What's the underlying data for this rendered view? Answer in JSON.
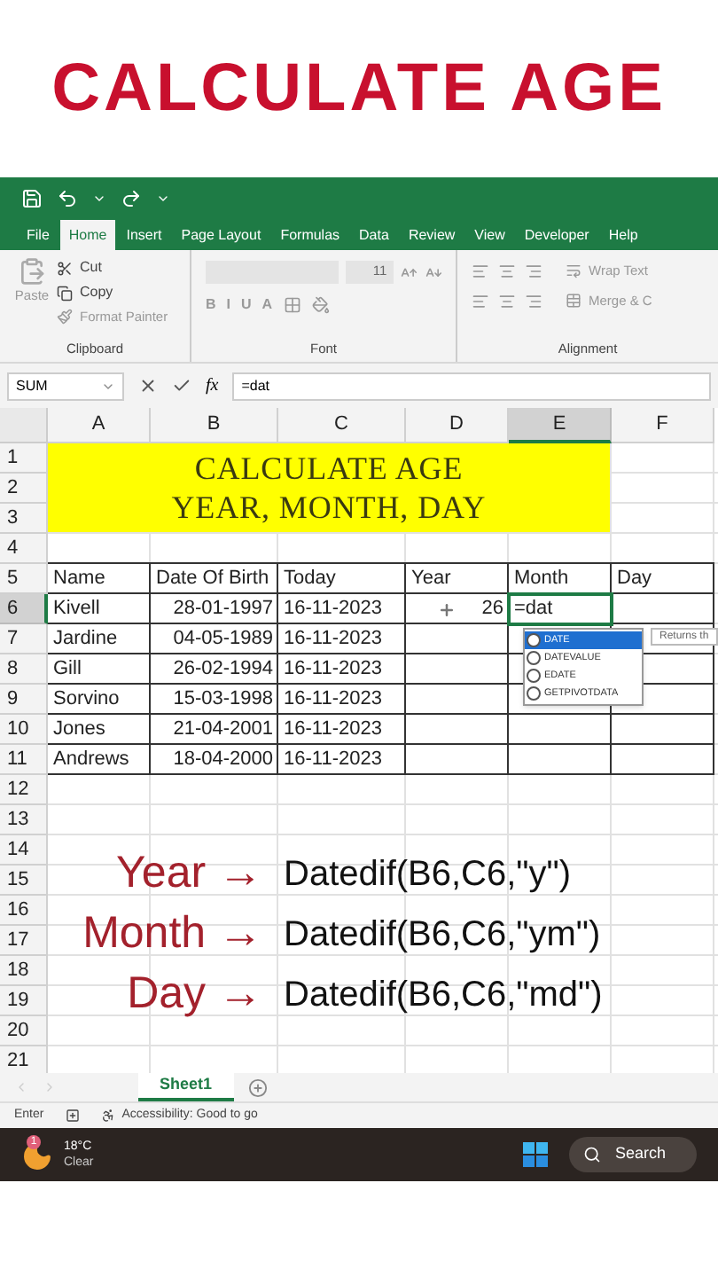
{
  "headline": "CALCULATE AGE",
  "ribbon_tabs": [
    {
      "label": "File",
      "selected": false
    },
    {
      "label": "Home",
      "selected": true
    },
    {
      "label": "Insert",
      "selected": false
    },
    {
      "label": "Page Layout",
      "selected": false
    },
    {
      "label": "Formulas",
      "selected": false
    },
    {
      "label": "Data",
      "selected": false
    },
    {
      "label": "Review",
      "selected": false
    },
    {
      "label": "View",
      "selected": false
    },
    {
      "label": "Developer",
      "selected": false
    },
    {
      "label": "Help",
      "selected": false
    }
  ],
  "clipboard": {
    "paste": "Paste",
    "cut": "Cut",
    "copy": "Copy",
    "format_painter": "Format Painter",
    "group": "Clipboard"
  },
  "font": {
    "size": "11",
    "buttons": [
      "B",
      "I",
      "U",
      "A"
    ],
    "group": "Font"
  },
  "alignment": {
    "wrap": "Wrap Text",
    "merge": "Merge & C",
    "group": "Alignment"
  },
  "formula_bar": {
    "name_box": "SUM",
    "fx": "fx",
    "formula": "=dat"
  },
  "columns": [
    {
      "label": "A",
      "selected": false
    },
    {
      "label": "B",
      "selected": false
    },
    {
      "label": "C",
      "selected": false
    },
    {
      "label": "D",
      "selected": false
    },
    {
      "label": "E",
      "selected": true
    },
    {
      "label": "F",
      "selected": false
    }
  ],
  "title_block": [
    "CALCULATE AGE",
    "YEAR, MONTH, DAY"
  ],
  "rows": [
    {
      "number": "1",
      "selected": false
    },
    {
      "number": "2",
      "selected": false
    },
    {
      "number": "3",
      "selected": false
    },
    {
      "number": "4",
      "selected": false
    },
    {
      "number": "5",
      "selected": false,
      "cells": [
        "Name",
        "Date Of Birth",
        "Today",
        "Year",
        "Month",
        "Day"
      ]
    },
    {
      "number": "6",
      "selected": true,
      "cells": [
        "Kivell",
        {
          "text": "28-01-1997",
          "kind": "number"
        },
        "16-11-2023",
        {
          "text": "26",
          "kind": "number"
        },
        {
          "text": "=dat",
          "kind": "editing"
        },
        ""
      ]
    },
    {
      "number": "7",
      "selected": false,
      "cells": [
        "Jardine",
        {
          "text": "04-05-1989",
          "kind": "number"
        },
        "16-11-2023",
        "",
        "",
        ""
      ]
    },
    {
      "number": "8",
      "selected": false,
      "cells": [
        "Gill",
        {
          "text": "26-02-1994",
          "kind": "number"
        },
        "16-11-2023",
        "",
        "",
        ""
      ]
    },
    {
      "number": "9",
      "selected": false,
      "cells": [
        "Sorvino",
        {
          "text": "15-03-1998",
          "kind": "number"
        },
        "16-11-2023",
        "",
        "",
        ""
      ]
    },
    {
      "number": "10",
      "selected": false,
      "cells": [
        "Jones",
        {
          "text": "21-04-2001",
          "kind": "number"
        },
        "16-11-2023",
        "",
        "",
        ""
      ]
    },
    {
      "number": "11",
      "selected": false,
      "cells": [
        "Andrews",
        {
          "text": "18-04-2000",
          "kind": "number"
        },
        "16-11-2023",
        "",
        "",
        ""
      ]
    },
    {
      "number": "12",
      "selected": false
    },
    {
      "number": "13",
      "selected": false
    },
    {
      "number": "14",
      "selected": false
    },
    {
      "number": "15",
      "selected": false
    },
    {
      "number": "16",
      "selected": false
    },
    {
      "number": "17",
      "selected": false
    },
    {
      "number": "18",
      "selected": false
    },
    {
      "number": "19",
      "selected": false
    },
    {
      "number": "20",
      "selected": false
    },
    {
      "number": "21",
      "selected": false
    }
  ],
  "autocomplete": {
    "items": [
      {
        "label": "DATE",
        "selected": true
      },
      {
        "label": "DATEVALUE",
        "selected": false
      },
      {
        "label": "EDATE",
        "selected": false
      },
      {
        "label": "GETPIVOTDATA",
        "selected": false
      }
    ],
    "tooltip": "Returns th"
  },
  "annotations": [
    {
      "label": "Year",
      "arrow": "→",
      "formula": "Datedif(B6,C6,\"y\")"
    },
    {
      "label": "Month",
      "arrow": "→",
      "formula": "Datedif(B6,C6,\"ym\")"
    },
    {
      "label": "Day",
      "arrow": "→",
      "formula": "Datedif(B6,C6,\"md\")"
    }
  ],
  "sheet_tabs": [
    {
      "label": "Sheet1",
      "selected": true
    }
  ],
  "status_bar": {
    "mode": "Enter",
    "accessibility": "Accessibility: Good to go"
  },
  "taskbar": {
    "badge": "1",
    "temperature": "18°C",
    "condition": "Clear",
    "search": "Search"
  }
}
